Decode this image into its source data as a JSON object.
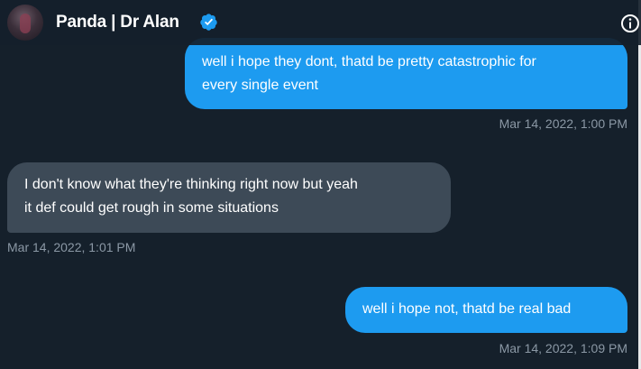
{
  "header": {
    "name": "Panda | Dr Alan",
    "verified_icon": "verified-badge-icon",
    "info_icon": "info-icon"
  },
  "colors": {
    "background": "#15202b",
    "outgoing_bubble": "#1d9bf0",
    "incoming_bubble": "#3d4a57",
    "timestamp": "#8b98a5"
  },
  "messages": [
    {
      "direction": "outgoing",
      "lines": [
        "well i hope they dont, thatd be pretty catastrophic for",
        "every single event"
      ],
      "timestamp": "Mar 14, 2022, 1:00 PM"
    },
    {
      "direction": "incoming",
      "lines": [
        "I don't know what they're thinking right now but yeah",
        "it def could get rough in some situations"
      ],
      "timestamp": "Mar 14, 2022, 1:01 PM"
    },
    {
      "direction": "outgoing",
      "lines": [
        "well i hope not, thatd be real bad"
      ],
      "timestamp": "Mar 14, 2022, 1:09 PM"
    }
  ]
}
